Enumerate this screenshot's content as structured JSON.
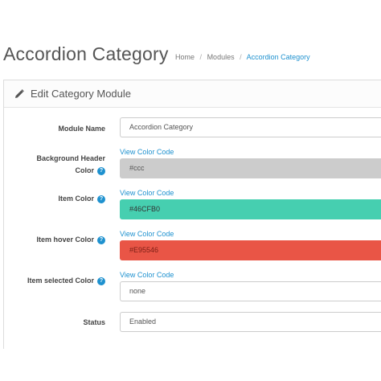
{
  "header": {
    "title": "Accordion Category",
    "breadcrumb": [
      "Home",
      "Modules",
      "Accordion Category"
    ]
  },
  "panel": {
    "icon": "pencil-icon",
    "title": "Edit Category Module"
  },
  "form": {
    "module_name": {
      "label": "Module Name",
      "value": "Accordion Category"
    },
    "bg_header_color": {
      "label_line1": "Background Header",
      "label_line2": "Color",
      "link": "View Color Code",
      "value": "#ccc",
      "swatch": "#cccccc"
    },
    "item_color": {
      "label": "Item Color",
      "link": "View Color Code",
      "value": "#46CFB0",
      "swatch": "#46cfb0"
    },
    "item_hover_color": {
      "label": "Item hover Color",
      "link": "View Color Code",
      "value": "#E95546",
      "swatch": "#e95546"
    },
    "item_selected_color": {
      "label": "Item selected Color",
      "link": "View Color Code",
      "value": "none"
    },
    "status": {
      "label": "Status",
      "value": "Enabled"
    }
  },
  "colors": {
    "accent": "#1e91cf"
  }
}
